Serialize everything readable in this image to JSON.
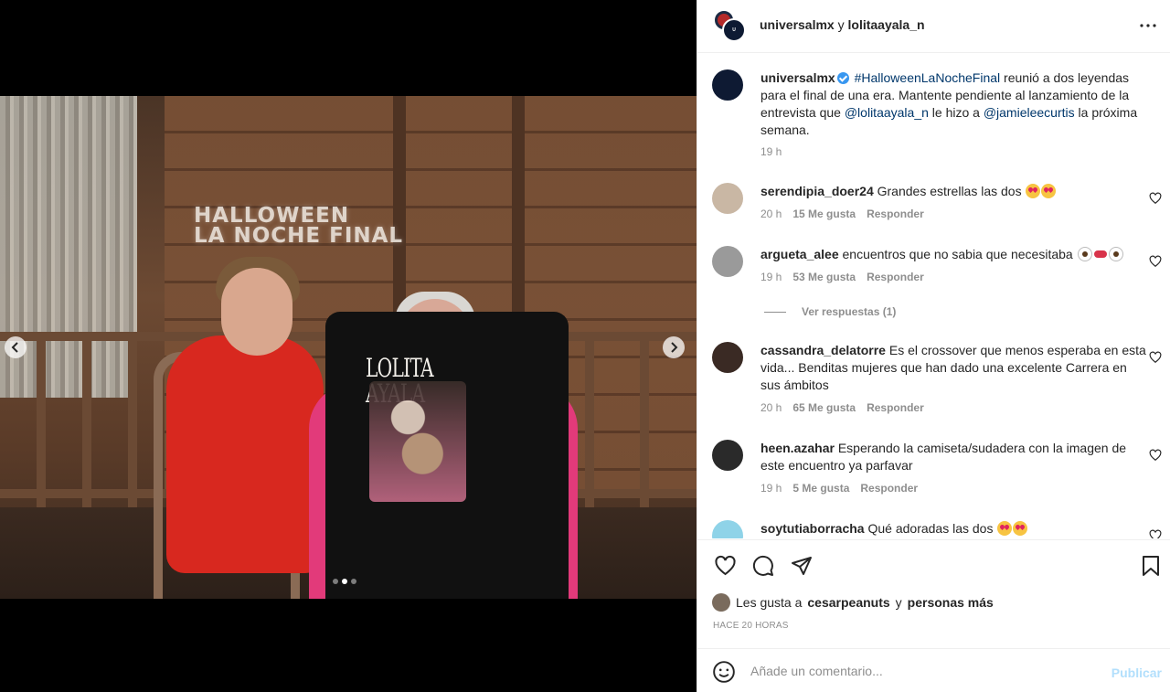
{
  "header": {
    "user1": "universalmx",
    "connector": "y",
    "user2": "lolitaayala_n",
    "more_icon": "more-horizontal-icon"
  },
  "photo": {
    "sign_line1": "HALLOWEEN",
    "sign_line2": "LA NOCHE FINAL",
    "shirt_text": "LOLITA AYALA",
    "carousel": {
      "total": 3,
      "active_index": 1
    }
  },
  "caption": {
    "username": "universalmx",
    "hashtag": "#HalloweenLaNocheFinal",
    "text1": " reunió a dos leyendas para el final de una era. Mantente pendiente al lanzamiento de la entrevista que ",
    "mention1": "@lolitaayala_n",
    "text2": " le hizo a ",
    "mention2": "@jamieleecurtis",
    "text3": " la próxima semana.",
    "time": "19 h"
  },
  "comments": [
    {
      "username": "serendipia_doer24",
      "text": "Grandes estrellas las dos",
      "emojis": [
        "heart-eyes",
        "heart-eyes"
      ],
      "time": "20 h",
      "likes": "15 Me gusta",
      "reply": "Responder"
    },
    {
      "username": "argueta_alee",
      "text": "encuentros que no sabia que necesitaba",
      "emojis": [
        "eye",
        "lips",
        "eye"
      ],
      "time": "19 h",
      "likes": "53 Me gusta",
      "reply": "Responder",
      "view_replies": "Ver respuestas (1)"
    },
    {
      "username": "cassandra_delatorre",
      "text": "Es el crossover que menos esperaba en esta vida... Benditas mujeres que han dado una excelente Carrera en sus ámbitos",
      "emojis": [],
      "time": "20 h",
      "likes": "65 Me gusta",
      "reply": "Responder"
    },
    {
      "username": "heen.azahar",
      "text": "Esperando la camiseta/sudadera con la imagen de este encuentro ya parfavar",
      "emojis": [],
      "time": "19 h",
      "likes": "5 Me gusta",
      "reply": "Responder"
    },
    {
      "username": "soytutiaborracha",
      "text": "Qué adoradas las dos",
      "emojis": [
        "heart-eyes",
        "heart-eyes"
      ]
    }
  ],
  "likes_line": {
    "prefix": "Les gusta a",
    "user": "cesarpeanuts",
    "connector": "y",
    "others": "personas más"
  },
  "timestamp": "HACE 20 HORAS",
  "composer": {
    "placeholder": "Añade un comentario...",
    "post_label": "Publicar"
  },
  "colors": {
    "link": "#00376b",
    "muted": "#8e8e8e",
    "verified": "#3897f0",
    "post_disabled": "#b2dffc"
  }
}
